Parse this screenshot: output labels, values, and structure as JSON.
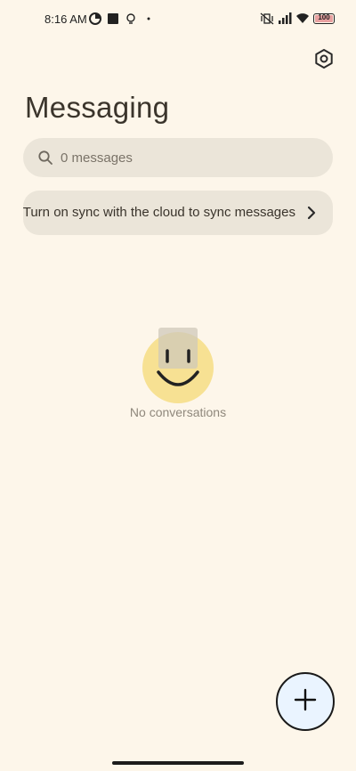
{
  "status_bar": {
    "time": "8:16 AM",
    "battery": "100",
    "left_icons": [
      "data-saver-icon",
      "square-app-icon",
      "bulb-icon",
      "dot-icon"
    ],
    "right_icons": [
      "vibrate-off-icon",
      "signal-icon",
      "wifi-icon",
      "battery-icon"
    ]
  },
  "header": {
    "title": "Messaging",
    "settings_icon": "settings-icon"
  },
  "search": {
    "placeholder": "0 messages"
  },
  "sync_banner": {
    "text": "Turn on sync with the cloud to sync messages"
  },
  "empty_state": {
    "label": "No conversations"
  },
  "fab": {
    "icon": "plus-icon"
  },
  "colors": {
    "background": "#fdf6ea",
    "card": "#ebe5d9",
    "fab_bg": "#eaf4ff",
    "smiley_yellow": "#f6df8a"
  }
}
